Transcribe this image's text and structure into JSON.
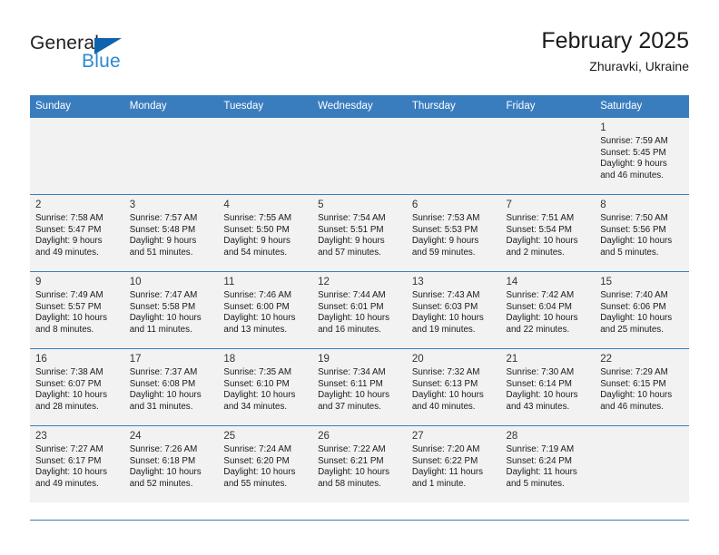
{
  "brand": {
    "name_top": "General",
    "name_bottom": "Blue",
    "triangle_color": "#0f63ad",
    "blue_color": "#2b8ad4"
  },
  "header": {
    "title": "February 2025",
    "subtitle": "Zhuravki, Ukraine"
  },
  "theme": {
    "header_bg": "#3a7dbf",
    "header_text": "#ffffff",
    "shaded_row_bg": "#f2f2f2",
    "cell_bg": "#ffffff",
    "grid_line": "#3a7dbf"
  },
  "weekdays": [
    "Sunday",
    "Monday",
    "Tuesday",
    "Wednesday",
    "Thursday",
    "Friday",
    "Saturday"
  ],
  "weeks": [
    {
      "shaded": true,
      "days": [
        {
          "num": "",
          "info": ""
        },
        {
          "num": "",
          "info": ""
        },
        {
          "num": "",
          "info": ""
        },
        {
          "num": "",
          "info": ""
        },
        {
          "num": "",
          "info": ""
        },
        {
          "num": "",
          "info": ""
        },
        {
          "num": "1",
          "info": "Sunrise: 7:59 AM\nSunset: 5:45 PM\nDaylight: 9 hours\nand 46 minutes."
        }
      ]
    },
    {
      "shaded": true,
      "days": [
        {
          "num": "2",
          "info": "Sunrise: 7:58 AM\nSunset: 5:47 PM\nDaylight: 9 hours\nand 49 minutes."
        },
        {
          "num": "3",
          "info": "Sunrise: 7:57 AM\nSunset: 5:48 PM\nDaylight: 9 hours\nand 51 minutes."
        },
        {
          "num": "4",
          "info": "Sunrise: 7:55 AM\nSunset: 5:50 PM\nDaylight: 9 hours\nand 54 minutes."
        },
        {
          "num": "5",
          "info": "Sunrise: 7:54 AM\nSunset: 5:51 PM\nDaylight: 9 hours\nand 57 minutes."
        },
        {
          "num": "6",
          "info": "Sunrise: 7:53 AM\nSunset: 5:53 PM\nDaylight: 9 hours\nand 59 minutes."
        },
        {
          "num": "7",
          "info": "Sunrise: 7:51 AM\nSunset: 5:54 PM\nDaylight: 10 hours\nand 2 minutes."
        },
        {
          "num": "8",
          "info": "Sunrise: 7:50 AM\nSunset: 5:56 PM\nDaylight: 10 hours\nand 5 minutes."
        }
      ]
    },
    {
      "shaded": true,
      "days": [
        {
          "num": "9",
          "info": "Sunrise: 7:49 AM\nSunset: 5:57 PM\nDaylight: 10 hours\nand 8 minutes."
        },
        {
          "num": "10",
          "info": "Sunrise: 7:47 AM\nSunset: 5:58 PM\nDaylight: 10 hours\nand 11 minutes."
        },
        {
          "num": "11",
          "info": "Sunrise: 7:46 AM\nSunset: 6:00 PM\nDaylight: 10 hours\nand 13 minutes."
        },
        {
          "num": "12",
          "info": "Sunrise: 7:44 AM\nSunset: 6:01 PM\nDaylight: 10 hours\nand 16 minutes."
        },
        {
          "num": "13",
          "info": "Sunrise: 7:43 AM\nSunset: 6:03 PM\nDaylight: 10 hours\nand 19 minutes."
        },
        {
          "num": "14",
          "info": "Sunrise: 7:42 AM\nSunset: 6:04 PM\nDaylight: 10 hours\nand 22 minutes."
        },
        {
          "num": "15",
          "info": "Sunrise: 7:40 AM\nSunset: 6:06 PM\nDaylight: 10 hours\nand 25 minutes."
        }
      ]
    },
    {
      "shaded": true,
      "days": [
        {
          "num": "16",
          "info": "Sunrise: 7:38 AM\nSunset: 6:07 PM\nDaylight: 10 hours\nand 28 minutes."
        },
        {
          "num": "17",
          "info": "Sunrise: 7:37 AM\nSunset: 6:08 PM\nDaylight: 10 hours\nand 31 minutes."
        },
        {
          "num": "18",
          "info": "Sunrise: 7:35 AM\nSunset: 6:10 PM\nDaylight: 10 hours\nand 34 minutes."
        },
        {
          "num": "19",
          "info": "Sunrise: 7:34 AM\nSunset: 6:11 PM\nDaylight: 10 hours\nand 37 minutes."
        },
        {
          "num": "20",
          "info": "Sunrise: 7:32 AM\nSunset: 6:13 PM\nDaylight: 10 hours\nand 40 minutes."
        },
        {
          "num": "21",
          "info": "Sunrise: 7:30 AM\nSunset: 6:14 PM\nDaylight: 10 hours\nand 43 minutes."
        },
        {
          "num": "22",
          "info": "Sunrise: 7:29 AM\nSunset: 6:15 PM\nDaylight: 10 hours\nand 46 minutes."
        }
      ]
    },
    {
      "shaded": true,
      "days": [
        {
          "num": "23",
          "info": "Sunrise: 7:27 AM\nSunset: 6:17 PM\nDaylight: 10 hours\nand 49 minutes."
        },
        {
          "num": "24",
          "info": "Sunrise: 7:26 AM\nSunset: 6:18 PM\nDaylight: 10 hours\nand 52 minutes."
        },
        {
          "num": "25",
          "info": "Sunrise: 7:24 AM\nSunset: 6:20 PM\nDaylight: 10 hours\nand 55 minutes."
        },
        {
          "num": "26",
          "info": "Sunrise: 7:22 AM\nSunset: 6:21 PM\nDaylight: 10 hours\nand 58 minutes."
        },
        {
          "num": "27",
          "info": "Sunrise: 7:20 AM\nSunset: 6:22 PM\nDaylight: 11 hours\nand 1 minute."
        },
        {
          "num": "28",
          "info": "Sunrise: 7:19 AM\nSunset: 6:24 PM\nDaylight: 11 hours\nand 5 minutes."
        },
        {
          "num": "",
          "info": ""
        }
      ]
    }
  ]
}
